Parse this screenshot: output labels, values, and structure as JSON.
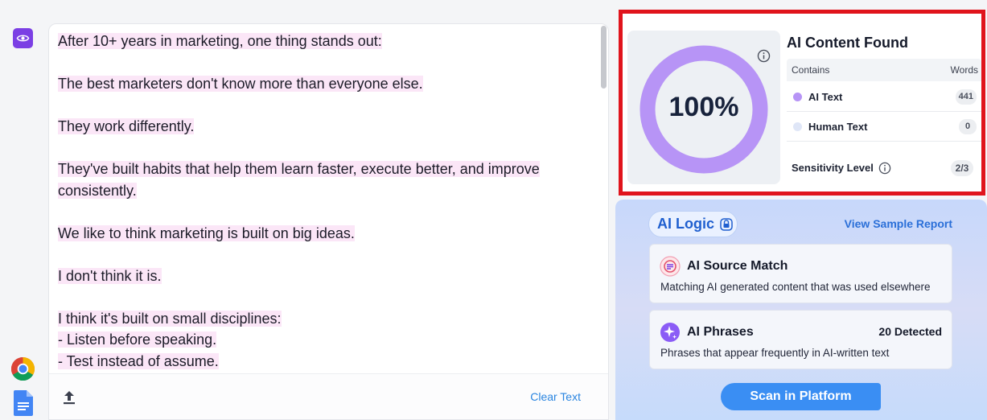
{
  "editor": {
    "paragraphs": [
      [
        "After 10+ years in marketing, one thing stands out:"
      ],
      [
        "The best marketers don't know more than everyone else."
      ],
      [
        "They work differently."
      ],
      [
        "They've built habits that help them learn faster, execute better, and improve",
        "consistently."
      ],
      [
        "We like to think marketing is built on big ideas."
      ],
      [
        "I don't think it is."
      ],
      [
        "I think it's built on small disciplines:",
        "- Listen before speaking.",
        "- Test instead of assume."
      ]
    ],
    "clear_label": "Clear Text"
  },
  "result": {
    "title": "AI Content Found",
    "percent_label": "100%",
    "ai_fraction": 1.0,
    "contains_label": "Contains",
    "words_label": "Words",
    "rows": [
      {
        "label": "AI Text",
        "count": "441",
        "color": "#b794f6"
      },
      {
        "label": "Human Text",
        "count": "0",
        "color": "#dfe6f7"
      }
    ],
    "sensitivity_label": "Sensitivity Level",
    "sensitivity_value": "2/3"
  },
  "logic": {
    "pill_label": "AI Logic",
    "sample_link": "View Sample Report",
    "cards": [
      {
        "title": "AI Source Match",
        "desc": "Matching AI generated content that was used elsewhere",
        "right": ""
      },
      {
        "title": "AI Phrases",
        "desc": "Phrases that appear frequently in AI-written text",
        "right": "20 Detected"
      }
    ],
    "scan_label": "Scan in Platform"
  },
  "colors": {
    "accent": "#7b3fe4",
    "highlight": "#fbe6f7",
    "donut": "#b794f6",
    "link": "#2a6fd8",
    "scan_button": "#3a8ef3",
    "frame": "#e0141c"
  }
}
